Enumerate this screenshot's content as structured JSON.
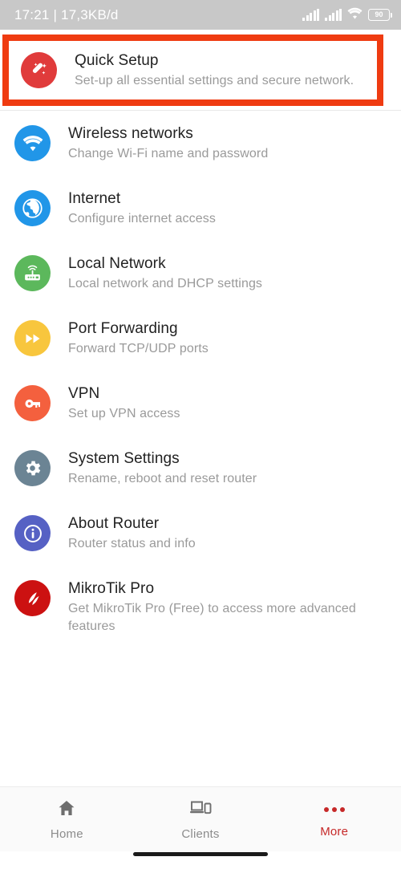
{
  "status_bar": {
    "time": "17:21",
    "separator": "|",
    "data_rate": "17,3KB/d",
    "signal_icon_1": "signal-bars-icon",
    "signal_icon_2": "signal-bars-icon",
    "wifi_icon": "wifi-icon",
    "battery_level": "90",
    "battery_icon": "battery-icon"
  },
  "highlight": {
    "color": "#ef3b11",
    "target": "Quick Setup"
  },
  "menu": {
    "items": [
      {
        "title": "Quick Setup",
        "subtitle": "Set-up all essential settings and secure network.",
        "icon": "magic-wand-icon",
        "icon_color": "#e03b3b",
        "highlighted": true
      },
      {
        "title": "Wireless networks",
        "subtitle": "Change Wi-Fi name and password",
        "icon": "wifi-icon",
        "icon_color": "#2196e8",
        "highlighted": false
      },
      {
        "title": "Internet",
        "subtitle": "Configure internet access",
        "icon": "globe-icon",
        "icon_color": "#2196e8",
        "highlighted": false
      },
      {
        "title": "Local Network",
        "subtitle": "Local network and DHCP settings",
        "icon": "router-icon",
        "icon_color": "#5cb85c",
        "highlighted": false
      },
      {
        "title": "Port Forwarding",
        "subtitle": "Forward TCP/UDP ports",
        "icon": "fast-forward-icon",
        "icon_color": "#f8c63d",
        "highlighted": false
      },
      {
        "title": "VPN",
        "subtitle": "Set up VPN access",
        "icon": "key-icon",
        "icon_color": "#f4603e",
        "highlighted": false
      },
      {
        "title": "System Settings",
        "subtitle": "Rename, reboot and reset router",
        "icon": "gear-icon",
        "icon_color": "#6b8494",
        "highlighted": false
      },
      {
        "title": "About Router",
        "subtitle": "Router status and info",
        "icon": "info-icon",
        "icon_color": "#5661c4",
        "highlighted": false
      },
      {
        "title": "MikroTik Pro",
        "subtitle": "Get MikroTik Pro (Free) to access more advanced features",
        "icon": "mikrotik-logo-icon",
        "icon_color": "#cc1111",
        "highlighted": false
      }
    ]
  },
  "bottom_nav": {
    "items": [
      {
        "label": "Home",
        "icon": "home-icon",
        "active": false
      },
      {
        "label": "Clients",
        "icon": "devices-icon",
        "active": false
      },
      {
        "label": "More",
        "icon": "more-dots-icon",
        "active": true
      }
    ],
    "active_color": "#c62828",
    "inactive_color": "#8c8c8c"
  }
}
